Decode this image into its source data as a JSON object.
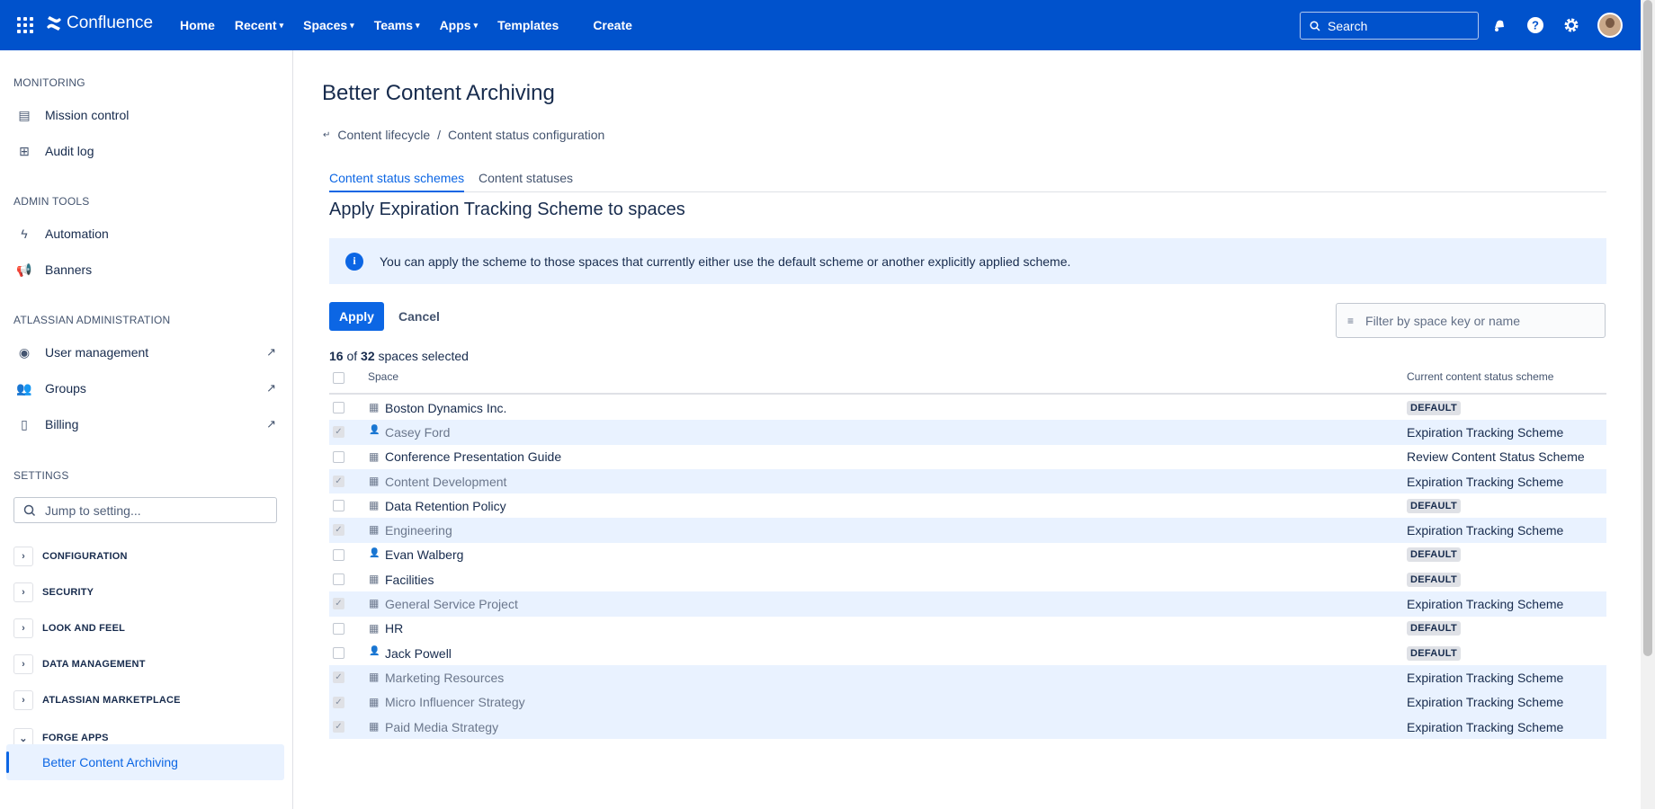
{
  "topbar": {
    "app_name": "Confluence",
    "nav": [
      "Home",
      "Recent",
      "Spaces",
      "Teams",
      "Apps",
      "Templates"
    ],
    "create": "Create",
    "search_placeholder": "Search"
  },
  "sidebar": {
    "monitoring": {
      "title": "MONITORING",
      "items": [
        {
          "label": "Mission control",
          "icon": "dashboard-icon"
        },
        {
          "label": "Audit log",
          "icon": "table-icon"
        }
      ]
    },
    "admin_tools": {
      "title": "ADMIN TOOLS",
      "items": [
        {
          "label": "Automation",
          "icon": "bolt-icon"
        },
        {
          "label": "Banners",
          "icon": "megaphone-icon"
        }
      ]
    },
    "atlassian_admin": {
      "title": "ATLASSIAN ADMINISTRATION",
      "items": [
        {
          "label": "User management",
          "icon": "person-icon"
        },
        {
          "label": "Groups",
          "icon": "people-icon"
        },
        {
          "label": "Billing",
          "icon": "billing-icon"
        }
      ]
    },
    "settings": {
      "title": "SETTINGS",
      "jump_placeholder": "Jump to setting...",
      "categories": [
        "CONFIGURATION",
        "SECURITY",
        "LOOK AND FEEL",
        "DATA MANAGEMENT",
        "ATLASSIAN MARKETPLACE",
        "FORGE APPS"
      ],
      "active_item": "Better Content Archiving"
    }
  },
  "main": {
    "title": "Better Content Archiving",
    "breadcrumbs": [
      "Content lifecycle",
      "/",
      "Content status configuration"
    ],
    "tabs": [
      "Content status schemes",
      "Content statuses"
    ],
    "heading": "Apply Expiration Tracking Scheme to spaces",
    "info": "You can apply the scheme to those spaces that currently either use the default scheme or another explicitly applied scheme.",
    "apply": "Apply",
    "cancel": "Cancel",
    "filter_placeholder": "Filter by space key or name",
    "count": {
      "selected": "16",
      "of": "of",
      "total": "32",
      "suffix": "spaces selected"
    },
    "columns": [
      "Space",
      "Current content status scheme"
    ],
    "rows": [
      {
        "name": "Boston Dynamics Inc.",
        "type": "space",
        "selected": false,
        "scheme": "DEFAULT",
        "is_default": true
      },
      {
        "name": "Casey Ford",
        "type": "person",
        "selected": true,
        "scheme": "Expiration Tracking Scheme",
        "is_default": false
      },
      {
        "name": "Conference Presentation Guide",
        "type": "space",
        "selected": false,
        "scheme": "Review Content Status Scheme",
        "is_default": false
      },
      {
        "name": "Content Development",
        "type": "space",
        "selected": true,
        "scheme": "Expiration Tracking Scheme",
        "is_default": false
      },
      {
        "name": "Data Retention Policy",
        "type": "space",
        "selected": false,
        "scheme": "DEFAULT",
        "is_default": true
      },
      {
        "name": "Engineering",
        "type": "space",
        "selected": true,
        "scheme": "Expiration Tracking Scheme",
        "is_default": false
      },
      {
        "name": "Evan Walberg",
        "type": "person",
        "selected": false,
        "scheme": "DEFAULT",
        "is_default": true
      },
      {
        "name": "Facilities",
        "type": "space",
        "selected": false,
        "scheme": "DEFAULT",
        "is_default": true
      },
      {
        "name": "General Service Project",
        "type": "space",
        "selected": true,
        "scheme": "Expiration Tracking Scheme",
        "is_default": false
      },
      {
        "name": "HR",
        "type": "space",
        "selected": false,
        "scheme": "DEFAULT",
        "is_default": true
      },
      {
        "name": "Jack Powell",
        "type": "person",
        "selected": false,
        "scheme": "DEFAULT",
        "is_default": true
      },
      {
        "name": "Marketing Resources",
        "type": "space",
        "selected": true,
        "scheme": "Expiration Tracking Scheme",
        "is_default": false
      },
      {
        "name": "Micro Influencer Strategy",
        "type": "space",
        "selected": true,
        "scheme": "Expiration Tracking Scheme",
        "is_default": false
      },
      {
        "name": "Paid Media Strategy",
        "type": "space",
        "selected": true,
        "scheme": "Expiration Tracking Scheme",
        "is_default": false
      }
    ]
  }
}
